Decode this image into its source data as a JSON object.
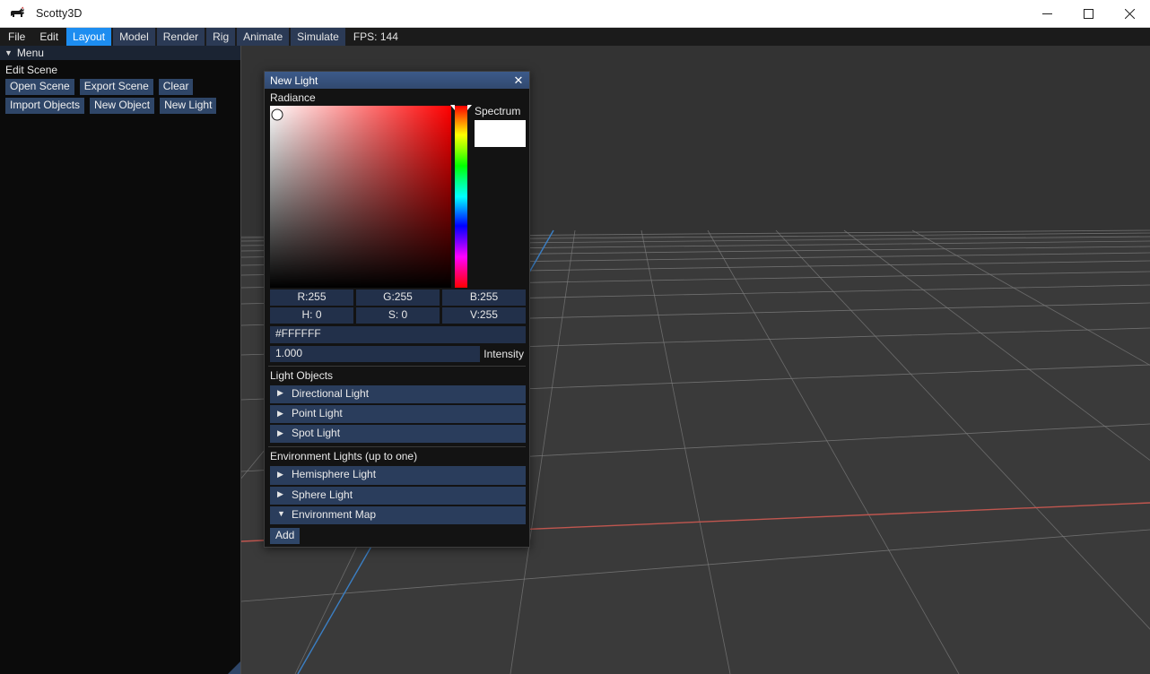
{
  "window": {
    "title": "Scotty3D",
    "app_icon": "scottie-dog-icon",
    "minimize_label": "Minimize",
    "maximize_label": "Maximize",
    "close_label": "Close"
  },
  "menubar": {
    "items": [
      {
        "label": "File",
        "active": false
      },
      {
        "label": "Edit",
        "active": false
      },
      {
        "label": "Layout",
        "active": true
      },
      {
        "label": "Model",
        "active": false
      },
      {
        "label": "Render",
        "active": false
      },
      {
        "label": "Rig",
        "active": false
      },
      {
        "label": "Animate",
        "active": false
      },
      {
        "label": "Simulate",
        "active": false
      }
    ],
    "fps": "FPS: 144"
  },
  "sidebar": {
    "header": {
      "label": "Menu",
      "collapse_glyph": "▼"
    },
    "section_label": "Edit Scene",
    "buttons_row1": [
      {
        "label": "Open Scene"
      },
      {
        "label": "Export Scene"
      },
      {
        "label": "Clear"
      }
    ],
    "buttons_row2": [
      {
        "label": "Import Objects"
      },
      {
        "label": "New Object"
      },
      {
        "label": "New Light"
      }
    ]
  },
  "dialog": {
    "title": "New Light",
    "close_glyph": "✕",
    "radiance_label": "Radiance",
    "spectrum_label": "Spectrum",
    "spectrum_color": "#FFFFFF",
    "color": {
      "r": "R:255",
      "g": "G:255",
      "b": "B:255",
      "h": "H:  0",
      "s": "S:  0",
      "v": "V:255",
      "hex": "#FFFFFF",
      "hue_degrees": 0,
      "saturation": 0,
      "value": 255
    },
    "intensity": {
      "value": "1.000",
      "label": "Intensity"
    },
    "light_objects": {
      "label": "Light Objects",
      "items": [
        {
          "label": "Directional Light",
          "expanded": false,
          "glyph": "▶"
        },
        {
          "label": "Point Light",
          "expanded": false,
          "glyph": "▶"
        },
        {
          "label": "Spot Light",
          "expanded": false,
          "glyph": "▶"
        }
      ]
    },
    "environment_lights": {
      "label": "Environment Lights (up to one)",
      "items": [
        {
          "label": "Hemisphere Light",
          "expanded": false,
          "glyph": "▶"
        },
        {
          "label": "Sphere Light",
          "expanded": false,
          "glyph": "▶"
        },
        {
          "label": "Environment Map",
          "expanded": true,
          "glyph": "▼"
        }
      ]
    },
    "add_button": "Add"
  },
  "viewport": {
    "background": "#3a3a3a",
    "grid_color": "#8a8a8a",
    "x_axis_color": "#c0564f",
    "z_axis_color": "#3b7fc4"
  },
  "theme": {
    "accent_active": "#1d8df0",
    "panel_blue": "#2f4668",
    "field_blue": "#22304a",
    "dialog_title": "#3c5a8a"
  }
}
